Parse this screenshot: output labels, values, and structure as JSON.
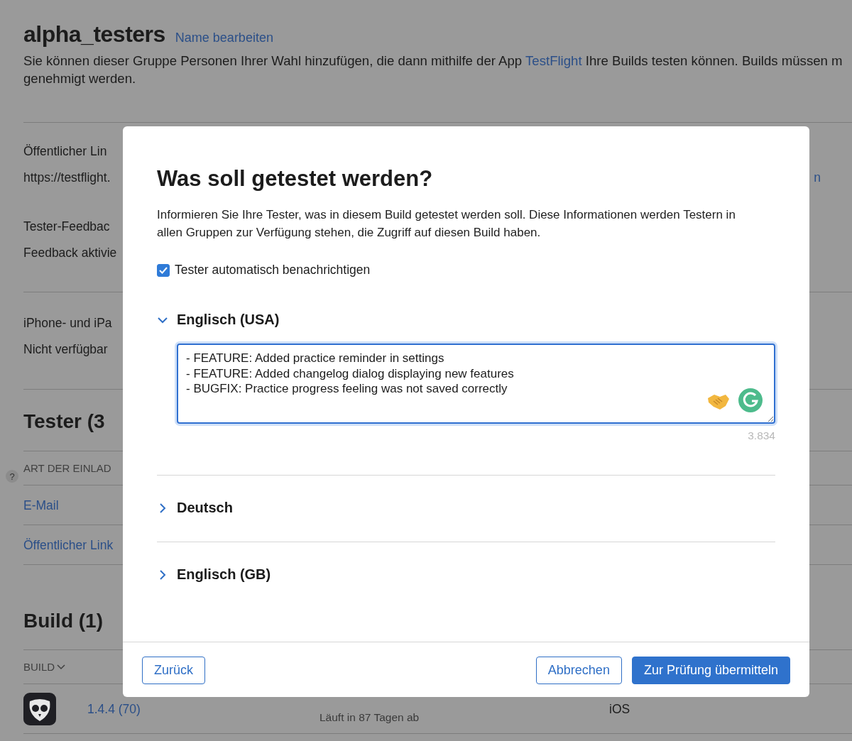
{
  "page": {
    "title": "alpha_testers",
    "edit_link": "Name bearbeiten",
    "description_before": "Sie können dieser Gruppe Personen Ihrer Wahl hinzufügen, die dann mithilfe der App",
    "description_link": "TestFlight",
    "description_after": "Ihre Builds testen können. Builds müssen m",
    "description_line2": "genehmigt werden.",
    "help": "?"
  },
  "settings": [
    {
      "label": "Öffentlicher Lin",
      "value": "https://testflight.",
      "action": "n"
    },
    {
      "label": "Tester-Feedbac",
      "value": "Feedback aktivie"
    },
    {
      "label": "iPhone- und iPa",
      "value": "Nicht verfügbar"
    }
  ],
  "testers": {
    "heading": "Tester (3",
    "column": "ART DER EINLAD",
    "rows": [
      "E-Mail",
      "Öffentlicher Link"
    ]
  },
  "builds": {
    "heading": "Build (1)",
    "column": "BUILD",
    "rows": [
      {
        "version": "1.4.4 (70)",
        "status_detail": "Läuft in 87 Tagen ab",
        "platform": "iOS"
      }
    ]
  },
  "modal": {
    "title": "Was soll getestet werden?",
    "description": "Informieren Sie Ihre Tester, was in diesem Build getestet werden soll. Diese Informationen werden Testern in allen Gruppen zur Verfügung stehen, die Zugriff auf diesen Build haben.",
    "notify": {
      "label": "Tester automatisch benachrichtigen",
      "checked": true
    },
    "locales": [
      {
        "name": "Englisch (USA)",
        "expanded": true,
        "notes": "- FEATURE: Added practice reminder in settings\n- FEATURE: Added changelog dialog displaying new features\n- BUGFIX: Practice progress feeling was not saved correctly",
        "counter": "3.834"
      },
      {
        "name": "Deutsch",
        "expanded": false
      },
      {
        "name": "Englisch (GB)",
        "expanded": false
      }
    ],
    "footer": {
      "back": "Zurück",
      "cancel": "Abbrechen",
      "submit": "Zur Prüfung übermitteln"
    }
  }
}
